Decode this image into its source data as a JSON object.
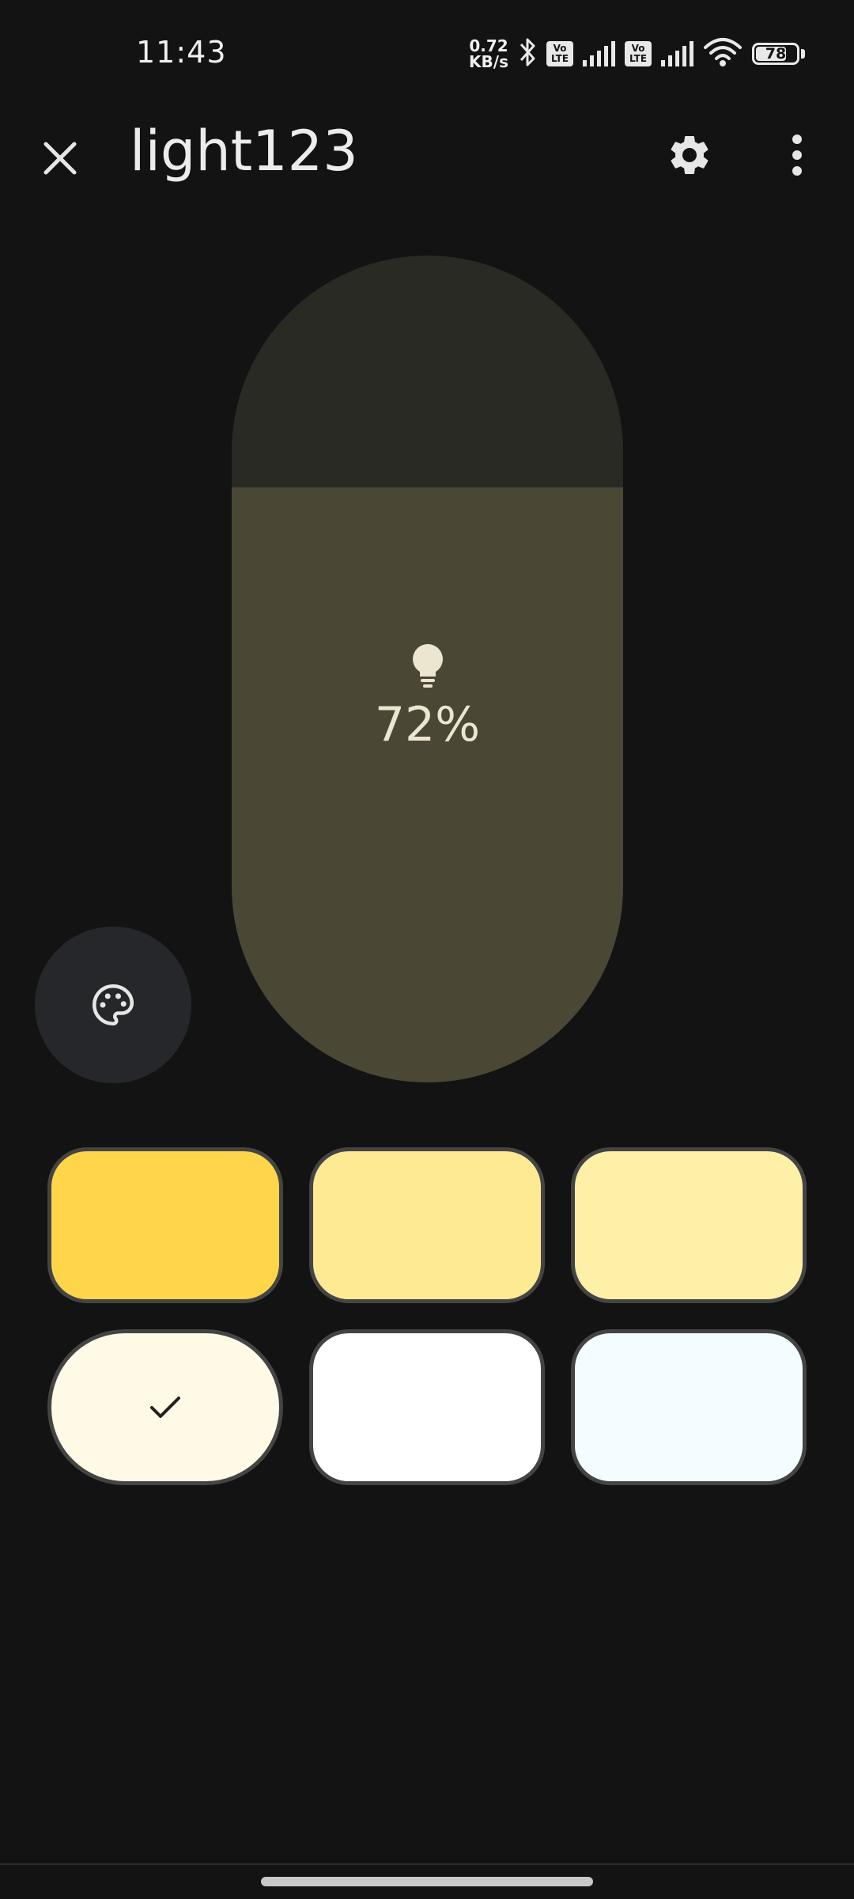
{
  "status_bar": {
    "time": "11:43",
    "net_speed_value": "0.72",
    "net_speed_unit": "KB/s",
    "volte_top": "Vo",
    "volte_bottom": "LTE",
    "battery_level": "78",
    "battery_percent": 78
  },
  "header": {
    "title": "light123",
    "close_icon": "close-icon",
    "settings_icon": "gear-icon",
    "more_icon": "more-vert-icon"
  },
  "brightness": {
    "level_percent": 72,
    "label": "72%",
    "icon": "lightbulb-icon"
  },
  "palette": {
    "icon": "palette-icon"
  },
  "swatches": [
    {
      "color": "#ffd54a",
      "selected": false
    },
    {
      "color": "#ffea94",
      "selected": false
    },
    {
      "color": "#fff0a8",
      "selected": false
    },
    {
      "color": "#fffae6",
      "selected": true
    },
    {
      "color": "#ffffff",
      "selected": false
    },
    {
      "color": "#f3fcff",
      "selected": false
    }
  ],
  "colors": {
    "background": "#131313",
    "slider_track": "#2a2a24",
    "slider_fill": "#4a4734",
    "palette_button": "#26272a",
    "swatch_border": "#444444"
  }
}
